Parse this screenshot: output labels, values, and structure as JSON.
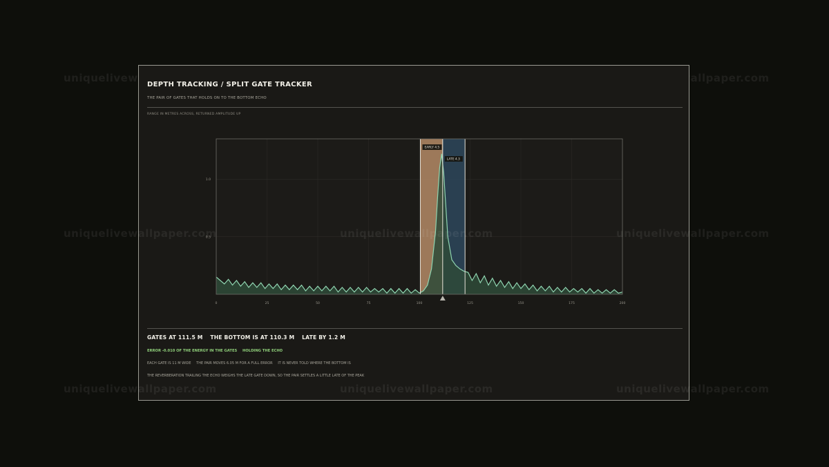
{
  "watermark": "uniquelivewallpaper.com",
  "header": {
    "title": "DEPTH TRACKING / SPLIT GATE TRACKER",
    "subtitle": "THE PAIR OF GATES THAT HOLDS ON TO THE BOTTOM ECHO",
    "caption": "RANGE IN METRES ACROSS, RETURNED AMPLITUDE UP"
  },
  "status": {
    "gates": "GATES AT 111.5 M",
    "bottom": "THE BOTTOM IS AT 110.3 M",
    "late": "LATE BY  1.2 M",
    "error": "ERROR -0.010 OF THE ENERGY IN THE GATES",
    "holding": "HOLDING THE ECHO",
    "note1a": "EACH GATE IS 11 M WIDE",
    "note1b": "THE PAIR MOVES 6.05 M FOR A FULL ERROR",
    "note1c": "IT IS NEVER TOLD WHERE THE BOTTOM IS",
    "note2": "THE REVERBERATION TRAILING THE ECHO WEIGHS THE LATE GATE DOWN, SO THE PAIR SETTLES A LITTLE LATE OF THE PEAK"
  },
  "colors": {
    "echo_line": "#8fd4b0",
    "echo_fill": "#2e4a38",
    "early_gate": "#b48a66",
    "late_gate": "#2c4558",
    "gate_edge": "#e8e4da"
  },
  "chart_data": {
    "type": "area",
    "title": "DEPTH TRACKING / SPLIT GATE TRACKER",
    "xlabel": "",
    "ylabel": "",
    "xlim": [
      0,
      200
    ],
    "ylim": [
      0,
      1.35
    ],
    "x_ticks": [
      0,
      25,
      50,
      75,
      100,
      125,
      150,
      175,
      200
    ],
    "x_tick_labels": [
      "0",
      "25",
      "50",
      "75",
      "100",
      "125",
      "150",
      "175",
      "200"
    ],
    "y_ticks": [
      0.5,
      1.0
    ],
    "y_tick_labels": [
      "0.5",
      "1.0"
    ],
    "grid": true,
    "gates": {
      "early": {
        "label": "EARLY  4.5",
        "start": 100.5,
        "end": 111.5,
        "value": 4.5
      },
      "late": {
        "label": "LATE  4.3",
        "start": 111.5,
        "end": 122.5,
        "value": 4.3
      },
      "center": 111.5
    },
    "bottom_position": 110.3,
    "series": [
      {
        "x": [
          0,
          2,
          4,
          6,
          8,
          10,
          12,
          14,
          16,
          18,
          20,
          22,
          24,
          26,
          28,
          30,
          32,
          34,
          36,
          38,
          40,
          42,
          44,
          46,
          48,
          50,
          52,
          54,
          56,
          58,
          60,
          62,
          64,
          66,
          68,
          70,
          72,
          74,
          76,
          78,
          80,
          82,
          84,
          86,
          88,
          90,
          92,
          94,
          96,
          98,
          100,
          102,
          104,
          106,
          108,
          109,
          110,
          111,
          112,
          113,
          114,
          116,
          118,
          120,
          122,
          124,
          126,
          128,
          130,
          132,
          134,
          136,
          138,
          140,
          142,
          144,
          146,
          148,
          150,
          152,
          154,
          156,
          158,
          160,
          162,
          164,
          166,
          168,
          170,
          172,
          174,
          176,
          178,
          180,
          182,
          184,
          186,
          188,
          190,
          192,
          194,
          196,
          198,
          200
        ],
        "values": [
          0.15,
          0.12,
          0.09,
          0.13,
          0.08,
          0.12,
          0.07,
          0.11,
          0.06,
          0.1,
          0.06,
          0.1,
          0.05,
          0.09,
          0.05,
          0.09,
          0.04,
          0.08,
          0.04,
          0.08,
          0.04,
          0.08,
          0.03,
          0.07,
          0.03,
          0.07,
          0.03,
          0.07,
          0.03,
          0.07,
          0.02,
          0.06,
          0.02,
          0.06,
          0.02,
          0.06,
          0.02,
          0.06,
          0.02,
          0.05,
          0.02,
          0.05,
          0.01,
          0.05,
          0.01,
          0.05,
          0.01,
          0.05,
          0.01,
          0.04,
          0.01,
          0.03,
          0.08,
          0.22,
          0.55,
          0.85,
          1.1,
          1.22,
          1.05,
          0.78,
          0.5,
          0.3,
          0.25,
          0.22,
          0.2,
          0.19,
          0.12,
          0.18,
          0.1,
          0.16,
          0.08,
          0.14,
          0.07,
          0.12,
          0.06,
          0.11,
          0.05,
          0.1,
          0.05,
          0.09,
          0.04,
          0.08,
          0.03,
          0.07,
          0.03,
          0.07,
          0.02,
          0.06,
          0.02,
          0.06,
          0.02,
          0.05,
          0.02,
          0.05,
          0.01,
          0.05,
          0.01,
          0.04,
          0.01,
          0.04,
          0.01,
          0.04,
          0.01,
          0.02
        ]
      }
    ]
  }
}
